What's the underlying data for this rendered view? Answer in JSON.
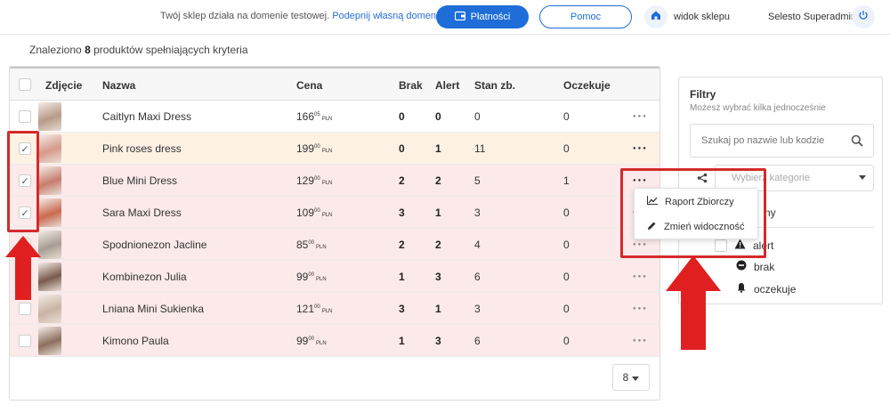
{
  "topbar": {
    "test_notice": "Twój sklep działa na domenie testowej.",
    "connect_domain_link": "Podepnij własną domenę",
    "payments_button": "Płatności",
    "help_button": "Pomoc",
    "shop_view": "widok sklepu",
    "user": "Selesto Superadmin"
  },
  "summary": {
    "prefix": "Znaleziono",
    "count": "8",
    "suffix": "produktów spełniających kryteria"
  },
  "table": {
    "headers": {
      "photo": "Zdjęcie",
      "name": "Nazwa",
      "price": "Cena",
      "missing": "Brak",
      "alert": "Alert",
      "stock": "Stan zb.",
      "pending": "Oczekuje"
    },
    "currency": "PLN",
    "rows": [
      {
        "name": "Caitlyn Maxi Dress",
        "price_main": "166",
        "price_cents": "05",
        "missing": "0",
        "alert": "0",
        "stock": "0",
        "pending": "0",
        "checked": false,
        "bg": "#ffffff",
        "thumb": "#b89a88"
      },
      {
        "name": "Pink roses dress",
        "price_main": "199",
        "price_cents": "00",
        "missing": "0",
        "alert": "1",
        "stock": "11",
        "pending": "0",
        "checked": true,
        "bg": "#fdf1e4",
        "thumb": "#d79a8c"
      },
      {
        "name": "Blue Mini Dress",
        "price_main": "129",
        "price_cents": "00",
        "missing": "2",
        "alert": "2",
        "stock": "5",
        "pending": "1",
        "checked": true,
        "bg": "#fce9e9",
        "thumb": "#c77d6e"
      },
      {
        "name": "Sara Maxi Dress",
        "price_main": "109",
        "price_cents": "00",
        "missing": "3",
        "alert": "1",
        "stock": "3",
        "pending": "0",
        "checked": true,
        "bg": "#fce9e9",
        "thumb": "#c96a4f"
      },
      {
        "name": "Spodnionezon Jacline",
        "price_main": "85",
        "price_cents": "00",
        "missing": "2",
        "alert": "2",
        "stock": "4",
        "pending": "0",
        "checked": false,
        "bg": "#fce9e9",
        "thumb": "#a89d94"
      },
      {
        "name": "Kombinezon Julia",
        "price_main": "99",
        "price_cents": "00",
        "missing": "1",
        "alert": "3",
        "stock": "6",
        "pending": "0",
        "checked": false,
        "bg": "#fce9e9",
        "thumb": "#7a5a4e"
      },
      {
        "name": "Lniana Mini Sukienka",
        "price_main": "121",
        "price_cents": "00",
        "missing": "3",
        "alert": "1",
        "stock": "3",
        "pending": "0",
        "checked": false,
        "bg": "#fce9e9",
        "thumb": "#c9b4a4"
      },
      {
        "name": "Kimono Paula",
        "price_main": "99",
        "price_cents": "00",
        "missing": "1",
        "alert": "3",
        "stock": "6",
        "pending": "0",
        "checked": false,
        "bg": "#fce9e9",
        "thumb": "#8c6f5e"
      }
    ],
    "page_size": "8"
  },
  "filters": {
    "title": "Filtry",
    "subtitle": "Możesz wybrać kilka jednocześnie",
    "search_placeholder": "Szukaj po nazwie lub kodzie",
    "category_placeholder": "Wybierz kategorie",
    "available_fragment": "ny",
    "items": [
      "alert",
      "brak",
      "oczekuje"
    ]
  },
  "dropdown": {
    "items": [
      "Raport Zbiorczy",
      "Zmień widoczność"
    ]
  },
  "colors": {
    "accent": "#1e6dd8",
    "annotation_red": "#d42a2a"
  }
}
